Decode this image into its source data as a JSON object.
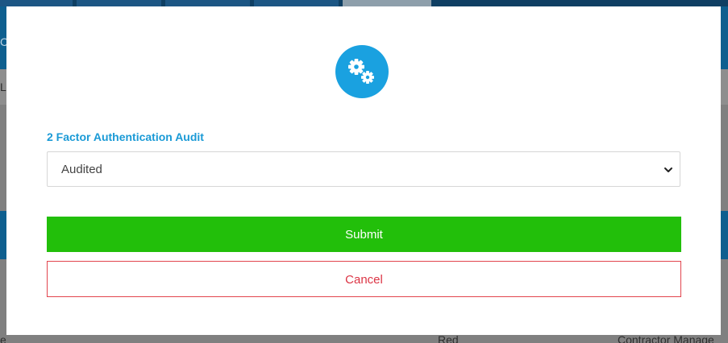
{
  "background": {
    "left_edge_fragments": [
      "C",
      "Li"
    ],
    "bottom_row": {
      "first_fragment": "e",
      "status": "Red",
      "role": "Contractor Manage"
    }
  },
  "modal": {
    "icon": "gears-icon",
    "field_label": "2 Factor Authentication Audit",
    "select": {
      "selected": "Audited",
      "icon": "chevron-down-icon"
    },
    "submit_label": "Submit",
    "cancel_label": "Cancel"
  },
  "colors": {
    "accent": "#1aa1e0",
    "label": "#1a9ad6",
    "submit_bg": "#22bf0a",
    "cancel_text": "#dc3545",
    "cancel_border": "#e2454e",
    "overlay": "#7a7a7a"
  }
}
